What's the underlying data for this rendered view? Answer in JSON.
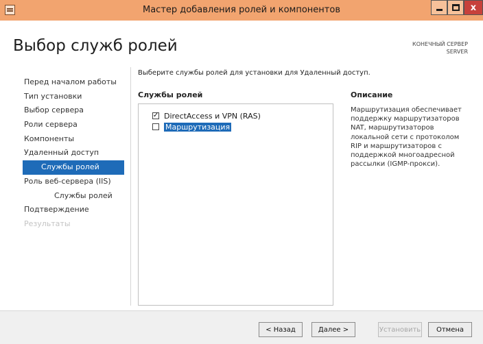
{
  "window": {
    "title": "Мастер добавления ролей и компонентов",
    "close_glyph": "x"
  },
  "page": {
    "title": "Выбор служб ролей",
    "destination_label": "КОНЕЧНЫЙ СЕРВЕР",
    "destination_server": "SERVER"
  },
  "nav": {
    "items": [
      {
        "label": "Перед началом работы"
      },
      {
        "label": "Тип установки"
      },
      {
        "label": "Выбор сервера"
      },
      {
        "label": "Роли сервера"
      },
      {
        "label": "Компоненты"
      },
      {
        "label": "Удаленный доступ"
      },
      {
        "label": "Службы ролей"
      },
      {
        "label": "Роль веб-сервера (IIS)"
      },
      {
        "label": "Службы ролей"
      },
      {
        "label": "Подтверждение"
      },
      {
        "label": "Результаты"
      }
    ]
  },
  "content": {
    "instruction": "Выберите службы ролей для установки для Удаленный доступ.",
    "services_header": "Службы ролей",
    "description_header": "Описание",
    "services": [
      {
        "label": "DirectAccess и VPN (RAS)",
        "checked": true,
        "check_glyph": "✓"
      },
      {
        "label": "Маршрутизация",
        "checked": false
      }
    ],
    "description": "Маршрутизация обеспечивает поддержку маршрутизаторов NAT, маршрутизаторов локальной сети с протоколом RIP и маршрутизаторов с поддержкой многоадресной рассылки (IGMP-прокси)."
  },
  "footer": {
    "back": "< Назад",
    "next": "Далее >",
    "install": "Установить",
    "cancel": "Отмена"
  },
  "colors": {
    "titlebar": "#f2a46f",
    "selection": "#1e6bb8",
    "close_button": "#c7413b"
  }
}
